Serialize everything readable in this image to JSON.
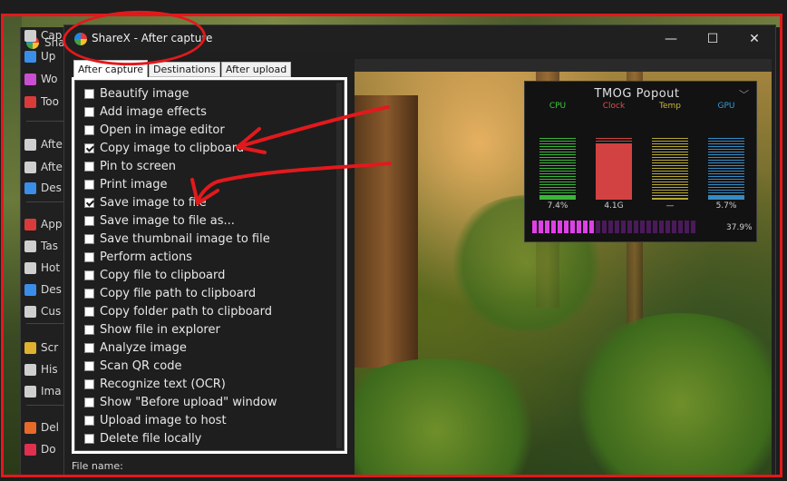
{
  "background_window": {
    "title": "Sha",
    "menu": [
      {
        "label": "Cap",
        "icon": "camera-icon",
        "color": "#cfcfcf"
      },
      {
        "label": "Up",
        "icon": "upload-arrow-icon",
        "color": "#3a8ee8"
      },
      {
        "label": "Wo",
        "icon": "workflow-grid-icon",
        "color": "#c94fd0"
      },
      {
        "label": "Too",
        "icon": "toolbox-icon",
        "color": "#d93b3b"
      },
      {
        "label": "Afte",
        "icon": "after-capture-icon",
        "color": "#cfcfcf"
      },
      {
        "label": "Afte",
        "icon": "after-upload-icon",
        "color": "#cfcfcf"
      },
      {
        "label": "Des",
        "icon": "destinations-icon",
        "color": "#3a8ee8"
      },
      {
        "label": "App",
        "icon": "app-settings-icon",
        "color": "#d93b3b"
      },
      {
        "label": "Tas",
        "icon": "task-settings-gear-icon",
        "color": "#cfcfcf"
      },
      {
        "label": "Hot",
        "icon": "hotkey-icon",
        "color": "#cfcfcf"
      },
      {
        "label": "Des",
        "icon": "destination-settings-icon",
        "color": "#3a8ee8"
      },
      {
        "label": "Cus",
        "icon": "custom-uploader-cloud-icon",
        "color": "#cfcfcf"
      },
      {
        "label": "Scr",
        "icon": "screenshots-folder-icon",
        "color": "#e0b030"
      },
      {
        "label": "His",
        "icon": "history-icon",
        "color": "#cfcfcf"
      },
      {
        "label": "Ima",
        "icon": "image-history-icon",
        "color": "#cfcfcf"
      },
      {
        "label": "Del",
        "icon": "debug-cone-icon",
        "color": "#e86a2a"
      },
      {
        "label": "Do",
        "icon": "donate-heart-icon",
        "color": "#e03050"
      }
    ]
  },
  "dialog": {
    "title": "ShareX - After capture",
    "controls": {
      "minimize": "—",
      "maximize": "☐",
      "close": "✕"
    },
    "tabs": [
      "After capture",
      "Destinations",
      "After upload"
    ],
    "options": [
      {
        "label": "Beautify image",
        "checked": false
      },
      {
        "label": "Add image effects",
        "checked": false
      },
      {
        "label": "Open in image editor",
        "checked": false
      },
      {
        "label": "Copy image to clipboard",
        "checked": true
      },
      {
        "label": "Pin to screen",
        "checked": false
      },
      {
        "label": "Print image",
        "checked": false
      },
      {
        "label": "Save image to file",
        "checked": true
      },
      {
        "label": "Save image to file as...",
        "checked": false
      },
      {
        "label": "Save thumbnail image to file",
        "checked": false
      },
      {
        "label": "Perform actions",
        "checked": false
      },
      {
        "label": "Copy file to clipboard",
        "checked": false
      },
      {
        "label": "Copy file path to clipboard",
        "checked": false
      },
      {
        "label": "Copy folder path to clipboard",
        "checked": false
      },
      {
        "label": "Show file in explorer",
        "checked": false
      },
      {
        "label": "Analyze image",
        "checked": false
      },
      {
        "label": "Scan QR code",
        "checked": false
      },
      {
        "label": "Recognize text (OCR)",
        "checked": false
      },
      {
        "label": "Show \"Before upload\" window",
        "checked": false
      },
      {
        "label": "Upload image to host",
        "checked": false
      },
      {
        "label": "Delete file locally",
        "checked": false
      }
    ],
    "file_name_label": "File name:"
  },
  "tmog": {
    "title": "TMOG Popout",
    "gauges": [
      {
        "label": "CPU",
        "value": "7.4%",
        "level": 0.074,
        "color": "#3ec83e"
      },
      {
        "label": "Clock",
        "value": "4.1G",
        "level": 0.9,
        "color": "#e84848"
      },
      {
        "label": "Temp",
        "value": "—",
        "level": 0.0,
        "color": "#c8b83a"
      },
      {
        "label": "GPU",
        "value": "5.7%",
        "level": 0.057,
        "color": "#3a9ad8"
      }
    ],
    "memory": {
      "value": "37.9%",
      "level": 0.379
    }
  },
  "annotation_color": "#e2191c"
}
